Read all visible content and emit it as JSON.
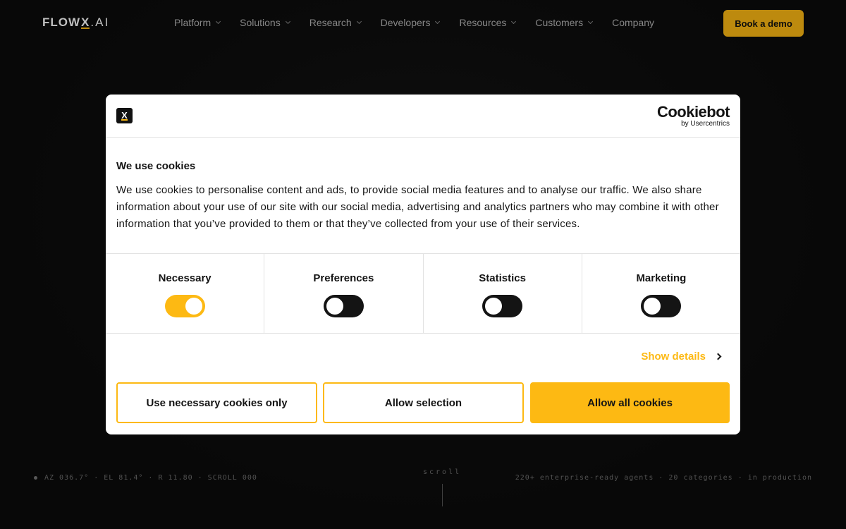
{
  "header": {
    "logo": {
      "flow": "FLOW",
      "x": "X",
      "ai": ".AI"
    },
    "nav": [
      {
        "label": "Platform",
        "has_dropdown": true,
        "name": "nav-platform"
      },
      {
        "label": "Solutions",
        "has_dropdown": true,
        "name": "nav-solutions"
      },
      {
        "label": "Research",
        "has_dropdown": true,
        "name": "nav-research"
      },
      {
        "label": "Developers",
        "has_dropdown": true,
        "name": "nav-developers"
      },
      {
        "label": "Resources",
        "has_dropdown": true,
        "name": "nav-resources"
      },
      {
        "label": "Customers",
        "has_dropdown": true,
        "name": "nav-customers"
      },
      {
        "label": "Company",
        "has_dropdown": false,
        "name": "nav-company"
      }
    ],
    "cta": "Book a demo"
  },
  "hud": {
    "left": "AZ 036.7° · EL 81.4° · R 11.80 · SCROLL 000",
    "center": "scroll",
    "right": "220+ enterprise-ready agents · 20 categories · in production"
  },
  "cookie_dialog": {
    "provider_name": "Cookiebot",
    "provider_sub": "by Usercentrics",
    "title": "We use cookies",
    "text": "We use cookies to personalise content and ads, to provide social media features and to analyse our traffic. We also share information about your use of our site with our social media, advertising and analytics partners who may combine it with other information that you’ve provided to them or that they’ve collected from your use of their services.",
    "categories": [
      {
        "label": "Necessary",
        "enabled": true
      },
      {
        "label": "Preferences",
        "enabled": false
      },
      {
        "label": "Statistics",
        "enabled": false
      },
      {
        "label": "Marketing",
        "enabled": false
      }
    ],
    "show_details": "Show details",
    "buttons": {
      "necessary_only": "Use necessary cookies only",
      "allow_selection": "Allow selection",
      "allow_all": "Allow all cookies"
    }
  },
  "colors": {
    "accent": "#fdb913",
    "background": "#0c0c0c",
    "dialog_bg": "#ffffff",
    "text_dark": "#141414"
  }
}
